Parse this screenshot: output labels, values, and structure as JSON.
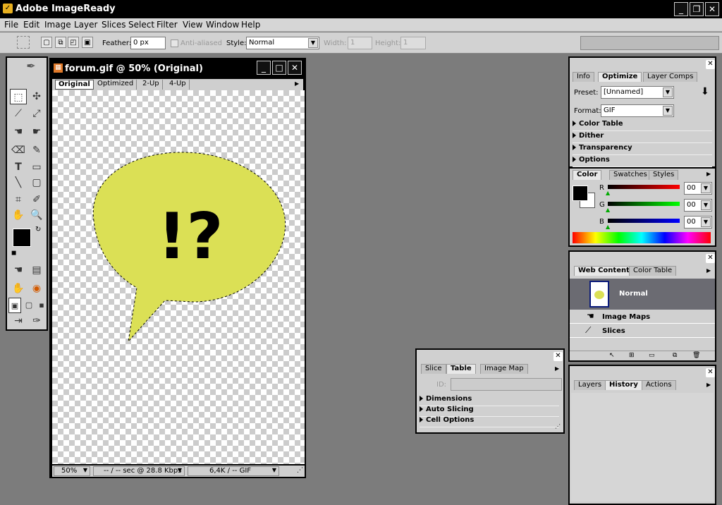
{
  "app": {
    "title": "Adobe ImageReady",
    "icon": "imageready-feather-icon"
  },
  "menu": [
    "File",
    "Edit",
    "Image",
    "Layer",
    "Slices",
    "Select",
    "Filter",
    "View",
    "Window",
    "Help"
  ],
  "options": {
    "feather_label": "Feather:",
    "feather_value": "0 px",
    "antialiased_label": "Anti-aliased",
    "style_label": "Style:",
    "style_value": "Normal",
    "width_label": "Width:",
    "width_value": "1",
    "height_label": "Height:",
    "height_value": "1"
  },
  "document": {
    "title": "forum.gif @ 50% (Original)",
    "tabs": [
      "Original",
      "Optimized",
      "2-Up",
      "4-Up"
    ],
    "active_tab": "Original",
    "bubble_text": "!?",
    "bubble_color": "#dbe055",
    "status_zoom": "50%",
    "status_time": "-- / -- sec @ 28.8 Kbps",
    "status_size": "6,4K / -- GIF"
  },
  "optimize_panel": {
    "tabs": [
      "Info",
      "Optimize",
      "Layer Comps"
    ],
    "preset_label": "Preset:",
    "preset_value": "[Unnamed]",
    "format_label": "Format:",
    "format_value": "GIF",
    "sections": [
      "Color Table",
      "Dither",
      "Transparency",
      "Options"
    ]
  },
  "color_panel": {
    "tabs": [
      "Color",
      "Swatches",
      "Styles"
    ],
    "channels": [
      {
        "name": "R",
        "value": "00",
        "color": "#cc0000"
      },
      {
        "name": "G",
        "value": "00",
        "color": "#00aa00"
      },
      {
        "name": "B",
        "value": "00",
        "color": "#0000cc"
      }
    ]
  },
  "web_content_panel": {
    "tabs": [
      "Web Content",
      "Color Table"
    ],
    "layer_name": "Normal",
    "items": [
      "Image Maps",
      "Slices"
    ]
  },
  "table_panel": {
    "tabs": [
      "Slice",
      "Table",
      "Image Map"
    ],
    "id_label": "ID:",
    "sections": [
      "Dimensions",
      "Auto Slicing",
      "Cell Options"
    ]
  },
  "history_panel": {
    "tabs": [
      "Layers",
      "History",
      "Actions"
    ]
  }
}
